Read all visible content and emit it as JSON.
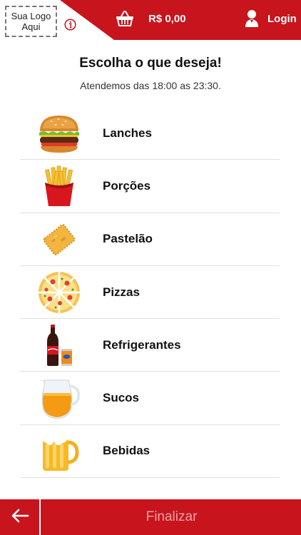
{
  "header": {
    "logo_text": "Sua Logo Aqui",
    "cart_total": "R$ 0,00",
    "login_label": "Login",
    "accent_color": "#c8141d"
  },
  "page": {
    "title": "Escolha o que deseja!",
    "hours": "Atendemos das 18:00 as 23:30."
  },
  "menu": {
    "items": [
      {
        "label": "Lanches",
        "icon": "burger-icon"
      },
      {
        "label": "Porções",
        "icon": "fries-icon"
      },
      {
        "label": "Pastelão",
        "icon": "pastel-icon"
      },
      {
        "label": "Pizzas",
        "icon": "pizza-icon"
      },
      {
        "label": "Refrigerantes",
        "icon": "soda-icon"
      },
      {
        "label": "Sucos",
        "icon": "juice-pitcher-icon"
      },
      {
        "label": "Bebidas",
        "icon": "beer-mug-icon"
      }
    ]
  },
  "footer": {
    "finalize_label": "Finalizar"
  }
}
